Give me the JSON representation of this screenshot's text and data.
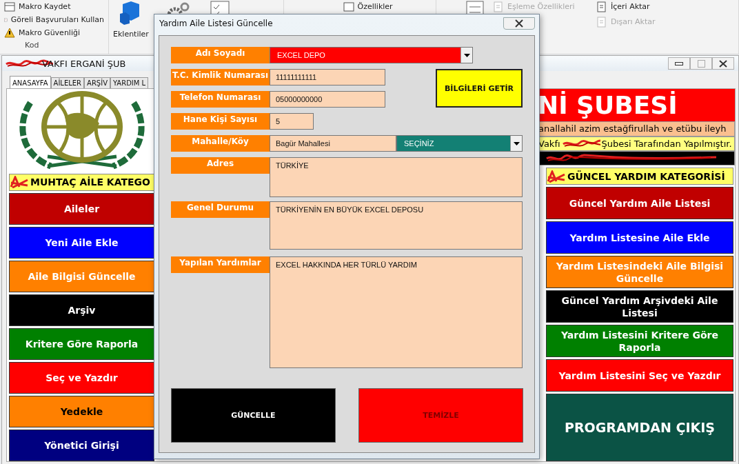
{
  "ribbon": {
    "code_group": {
      "items": [
        "Makro Kaydet",
        "Göreli Başvuruları Kullan",
        "Makro Güvenliği"
      ],
      "caption": "Kod"
    },
    "addins": {
      "label": "Eklentiler"
    },
    "controls": {
      "items": [
        "Özellikler"
      ]
    },
    "xml_group": {
      "items": [
        {
          "label": "Eşleme Özellikleri",
          "disabled": true
        },
        {
          "label": "İçeri Aktar",
          "disabled": false
        },
        {
          "label": "Dışarı Aktar",
          "disabled": true
        }
      ]
    }
  },
  "main_window": {
    "title": "VAKFI ERGANİ ŞUB",
    "tabs": [
      {
        "label": "ANASAYFA",
        "selected": true
      },
      {
        "label": "AİLELER",
        "selected": false
      },
      {
        "label": "ARŞİV",
        "selected": false
      },
      {
        "label": "YARDIM L",
        "selected": false
      }
    ],
    "left": {
      "header": "MUHTAÇ AİLE KATEGO",
      "buttons": [
        {
          "label": "Aileler",
          "color": "#c00000",
          "kind": "light"
        },
        {
          "label": "Yeni Aile Ekle",
          "color": "#0000ff",
          "kind": "light"
        },
        {
          "label": "Aile Bilgisi Güncelle",
          "color": "#ff8000",
          "kind": "light"
        },
        {
          "label": "Arşiv",
          "color": "#000000",
          "kind": "light"
        },
        {
          "label": "Kritere Göre Raporla",
          "color": "#008000",
          "kind": "light"
        },
        {
          "label": "Seç ve Yazdır",
          "color": "#ff0000",
          "kind": "light"
        },
        {
          "label": "Yedekle",
          "color": "#ff8000",
          "kind": "dark"
        },
        {
          "label": "Yönetici Girişi",
          "color": "#000080",
          "kind": "light"
        }
      ]
    },
    "right": {
      "banner": "Nİ ŞUBESİ",
      "motto": "anallahil azim estağfirullah ve etübu ileyh",
      "credit_start": "Vakfı",
      "credit_end": "Şubesi Tarafından Yapılmıştır.",
      "header": "GÜNCEL YARDIM KATEGORİSİ",
      "buttons": [
        {
          "label": "Güncel Yardım Aile Listesi",
          "color": "#c00000",
          "kind": "light"
        },
        {
          "label": "Yardım Listesine Aile Ekle",
          "color": "#0000ff",
          "kind": "light"
        },
        {
          "label": "Yardım Listesindeki Aile Bilgisi Güncelle",
          "color": "#ff8000",
          "kind": "light"
        },
        {
          "label": "Güncel Yardım Arşivdeki Aile Listesi",
          "color": "#000000",
          "kind": "light"
        },
        {
          "label": "Yardım Listesini Kritere Göre Raporla",
          "color": "#008000",
          "kind": "light"
        },
        {
          "label": "Yardım Listesini Seç ve Yazdır",
          "color": "#ff0000",
          "kind": "light"
        },
        {
          "label": "PROGRAMDAN ÇIKIŞ",
          "color": "#0b5345",
          "kind": "light"
        }
      ]
    }
  },
  "dialog": {
    "title": "Yardım Aile Listesi Güncelle",
    "fields": [
      {
        "label": "Adı Soyadı",
        "kind": "dropdown",
        "value": "EXCEL DEPO"
      },
      {
        "label": "T.C. Kimlik Numarası",
        "kind": "text",
        "value": "11111111111"
      },
      {
        "label": "Telefon Numarası",
        "kind": "text",
        "value": "05000000000"
      },
      {
        "label": "Hane Kişi Sayısı",
        "kind": "short",
        "value": "5"
      },
      {
        "label": "Mahalle/Köy",
        "kind": "text_dropdown",
        "value": "Bagür Mahallesi",
        "choice": "SEÇİNİZ"
      },
      {
        "label": "Adres",
        "kind": "multiline",
        "value": "TÜRKİYE"
      },
      {
        "label": "Genel Durumu",
        "kind": "multiline",
        "value": "TÜRKİYENİN EN BÜYÜK EXCEL DEPOSU"
      },
      {
        "label": "Yapılan Yardımlar",
        "kind": "tall",
        "value": "EXCEL HAKKINDA HER TÜRLÜ YARDIM"
      }
    ],
    "fetch_button": "BİLGİLERİ GETİR",
    "buttons": [
      {
        "label": "GÜNCELLE",
        "color": "#000000",
        "kind": "light"
      },
      {
        "label": "TEMİZLE",
        "color": "#ff0000",
        "kind": "maroon"
      }
    ]
  }
}
